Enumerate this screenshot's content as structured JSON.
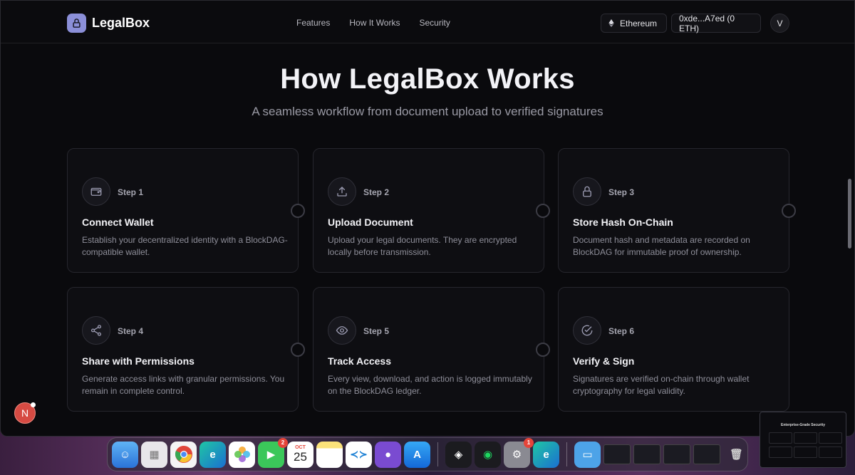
{
  "navbar": {
    "brand": "LegalBox",
    "links": [
      "Features",
      "How It Works",
      "Security"
    ],
    "network": "Ethereum",
    "wallet": "0xde...A7ed (0 ETH)",
    "avatar": "V"
  },
  "hero": {
    "title": "How LegalBox Works",
    "subtitle": "A seamless workflow from document upload to verified signatures"
  },
  "steps": [
    {
      "step": "Step 1",
      "title": "Connect Wallet",
      "desc": "Establish your decentralized identity with a BlockDAG-compatible wallet.",
      "icon": "wallet-icon"
    },
    {
      "step": "Step 2",
      "title": "Upload Document",
      "desc": "Upload your legal documents. They are encrypted locally before transmission.",
      "icon": "upload-icon"
    },
    {
      "step": "Step 3",
      "title": "Store Hash On-Chain",
      "desc": "Document hash and metadata are recorded on BlockDAG for immutable proof of ownership.",
      "icon": "lock-icon"
    },
    {
      "step": "Step 4",
      "title": "Share with Permissions",
      "desc": "Generate access links with granular permissions. You remain in complete control.",
      "icon": "share-icon"
    },
    {
      "step": "Step 5",
      "title": "Track Access",
      "desc": "Every view, download, and action is logged immutably on the BlockDAG ledger.",
      "icon": "eye-icon"
    },
    {
      "step": "Step 6",
      "title": "Verify & Sign",
      "desc": "Signatures are verified on-chain through wallet cryptography for legal validity.",
      "icon": "check-circle-icon"
    }
  ],
  "floating_badge": "N",
  "thumbnail_title": "Enterprise-Grade Security",
  "dock": {
    "calendar_month": "OCT",
    "calendar_day": "25",
    "facetime_badge": "2",
    "settings_badge": "1"
  },
  "colors": {
    "background": "#0a0a0d",
    "card_border": "#26262d",
    "accent": "#8b8fd8",
    "badge_red": "#d64b43"
  }
}
